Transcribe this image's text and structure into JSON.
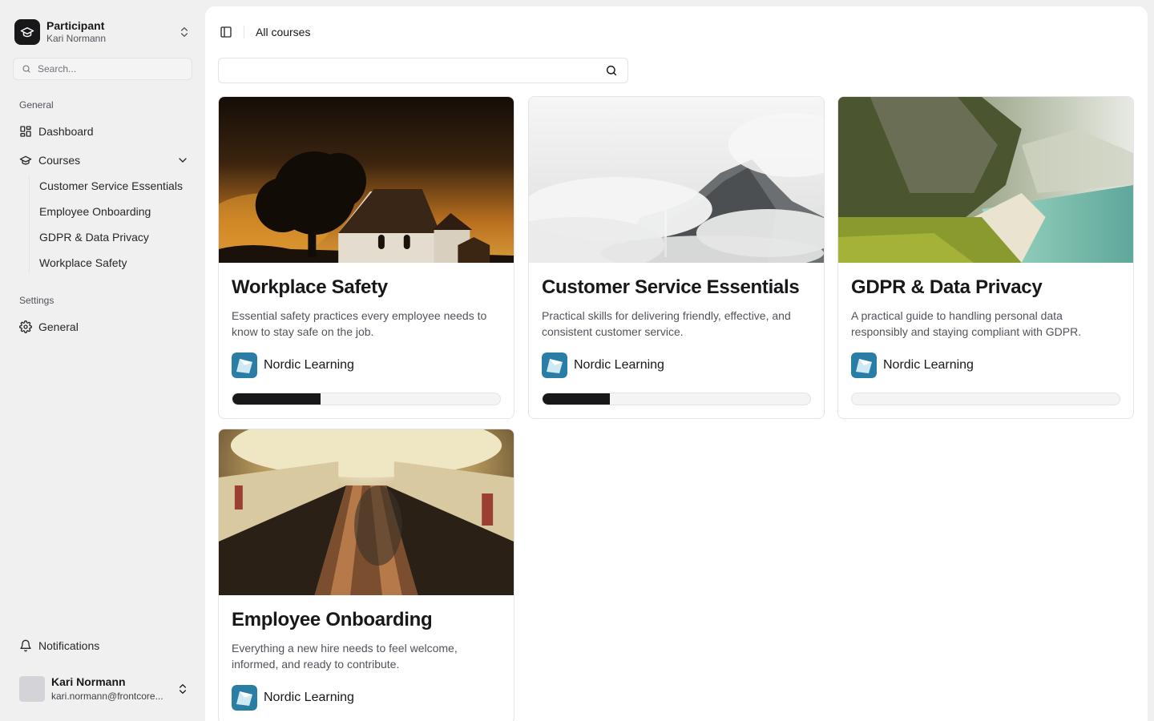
{
  "sidebar": {
    "org": {
      "name": "Participant",
      "user": "Kari Normann"
    },
    "search_placeholder": "Search...",
    "group_general": "General",
    "dashboard_label": "Dashboard",
    "courses_label": "Courses",
    "course_links": [
      {
        "label": "Customer Service Essentials"
      },
      {
        "label": "Employee Onboarding"
      },
      {
        "label": "GDPR & Data Privacy"
      },
      {
        "label": "Workplace Safety"
      }
    ],
    "group_settings": "Settings",
    "settings_general_label": "General",
    "notifications_label": "Notifications",
    "user": {
      "name": "Kari Normann",
      "email": "kari.normann@frontcore..."
    }
  },
  "header": {
    "breadcrumb": "All courses"
  },
  "search": {
    "placeholder": ""
  },
  "colors": {
    "accent": "#18181b",
    "provider_logo": "#2a7ea5"
  },
  "courses": [
    {
      "title": "Workplace Safety",
      "description": "Essential safety practices every employee needs to know to stay safe on the job.",
      "provider": "Nordic Learning",
      "progress": 0.33,
      "image": "church-at-night"
    },
    {
      "title": "Customer Service Essentials",
      "description": "Practical skills for delivering friendly, effective, and consistent customer service.",
      "provider": "Nordic Learning",
      "progress": 0.25,
      "image": "misty-mountains"
    },
    {
      "title": "GDPR & Data Privacy",
      "description": "A practical guide to handling personal data responsibly and staying compliant with GDPR.",
      "provider": "Nordic Learning",
      "progress": 0.0,
      "image": "coastal-cliffs"
    },
    {
      "title": "Employee Onboarding",
      "description": "Everything a new hire needs to feel welcome, informed, and ready to contribute.",
      "provider": "Nordic Learning",
      "progress": null,
      "image": "escalator-tunnel"
    }
  ]
}
